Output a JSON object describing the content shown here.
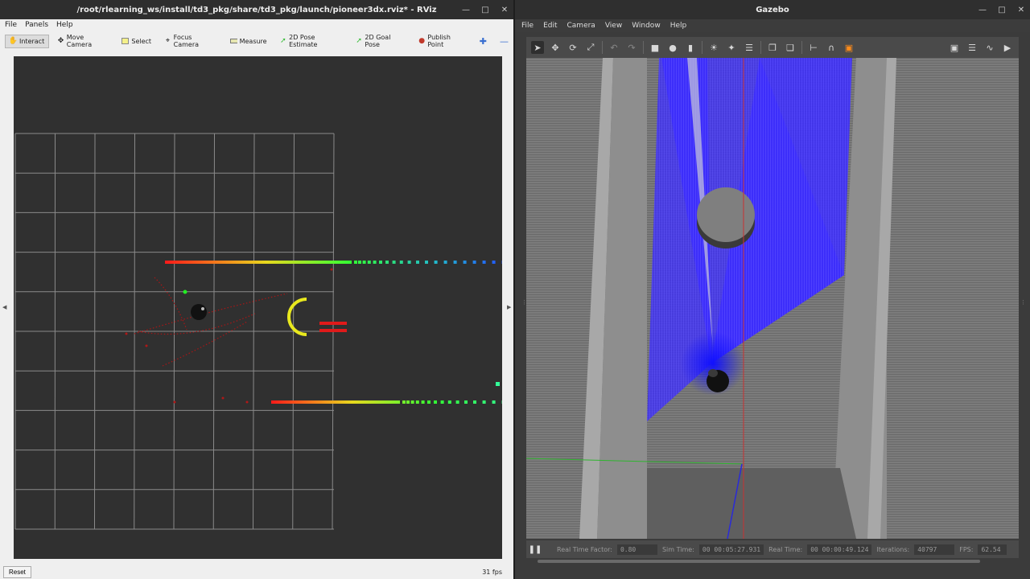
{
  "rviz": {
    "title": "/root/rlearning_ws/install/td3_pkg/share/td3_pkg/launch/pioneer3dx.rviz* - RViz",
    "menu": [
      "File",
      "Panels",
      "Help"
    ],
    "tools": [
      {
        "label": "Interact",
        "icon": "hand-icon"
      },
      {
        "label": "Move Camera",
        "icon": "move-camera-icon"
      },
      {
        "label": "Select",
        "icon": "select-icon"
      },
      {
        "label": "Focus Camera",
        "icon": "focus-icon"
      },
      {
        "label": "Measure",
        "icon": "ruler-icon"
      },
      {
        "label": "2D Pose Estimate",
        "icon": "pose-arrow-icon"
      },
      {
        "label": "2D Goal Pose",
        "icon": "goal-arrow-icon"
      },
      {
        "label": "Publish Point",
        "icon": "pin-icon"
      }
    ],
    "reset_label": "Reset",
    "fps": "31 fps"
  },
  "gazebo": {
    "title": "Gazebo",
    "menu": [
      "File",
      "Edit",
      "Camera",
      "View",
      "Window",
      "Help"
    ],
    "status": {
      "real_time_factor_label": "Real Time Factor:",
      "real_time_factor": "0.80",
      "sim_time_label": "Sim Time:",
      "sim_time": "00 00:05:27.931",
      "real_time_label": "Real Time:",
      "real_time": "00 00:00:49.124",
      "iterations_label": "Iterations:",
      "iterations": "40797",
      "fps_label": "FPS:",
      "fps": "62.54"
    }
  },
  "colors": {
    "laser_red": "#ff1a1a",
    "laser_green": "#33ff33",
    "laser_blue": "#2255ff",
    "goal_yellow": "#e8e81e",
    "scan_blue": "#3a2bff"
  }
}
